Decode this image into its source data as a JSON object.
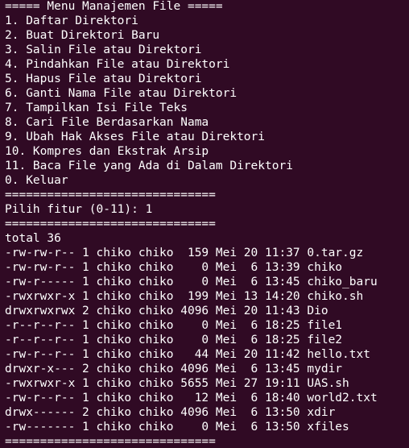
{
  "terminal": {
    "menu_header": "===== Menu Manajemen File =====",
    "menu_items": [
      "1. Daftar Direktori",
      "2. Buat Direktori Baru",
      "3. Salin File atau Direktori",
      "4. Pindahkan File atau Direktori",
      "5. Hapus File atau Direktori",
      "6. Ganti Nama File atau Direktori",
      "7. Tampilkan Isi File Teks",
      "8. Cari File Berdasarkan Nama",
      "9. Ubah Hak Akses File atau Direktori",
      "10. Kompres dan Ekstrak Arsip",
      "11. Baca File yang Ada di Dalam Direktori",
      "0. Keluar"
    ],
    "separator": "==============================",
    "prompt": "Pilih fitur (0-11): 1",
    "separator2": "==============================",
    "total": "total 36",
    "listing": [
      "-rw-rw-r-- 1 chiko chiko  159 Mei 20 11:37 0.tar.gz",
      "-rw-rw-r-- 1 chiko chiko    0 Mei  6 13:39 chiko",
      "-rw-r----- 1 chiko chiko    0 Mei  6 13:45 chiko_baru",
      "-rwxrwxr-x 1 chiko chiko  199 Mei 13 14:20 chiko.sh",
      "drwxrwxrwx 2 chiko chiko 4096 Mei 20 11:43 Dio",
      "-r--r--r-- 1 chiko chiko    0 Mei  6 18:25 file1",
      "-r--r--r-- 1 chiko chiko    0 Mei  6 18:25 file2",
      "-rw-r--r-- 1 chiko chiko   44 Mei 20 11:42 hello.txt",
      "drwxr-x--- 2 chiko chiko 4096 Mei  6 13:45 mydir",
      "-rwxrwxr-x 1 chiko chiko 5655 Mei 27 19:11 UAS.sh",
      "-rw-r--r-- 1 chiko chiko   12 Mei  6 18:40 world2.txt",
      "drwx------ 2 chiko chiko 4096 Mei  6 13:50 xdir",
      "-rw------- 1 chiko chiko    0 Mei  6 13:50 xfiles"
    ],
    "separator3": "=============================="
  },
  "colors": {
    "background": "#300a24",
    "foreground": "#ffffff"
  }
}
